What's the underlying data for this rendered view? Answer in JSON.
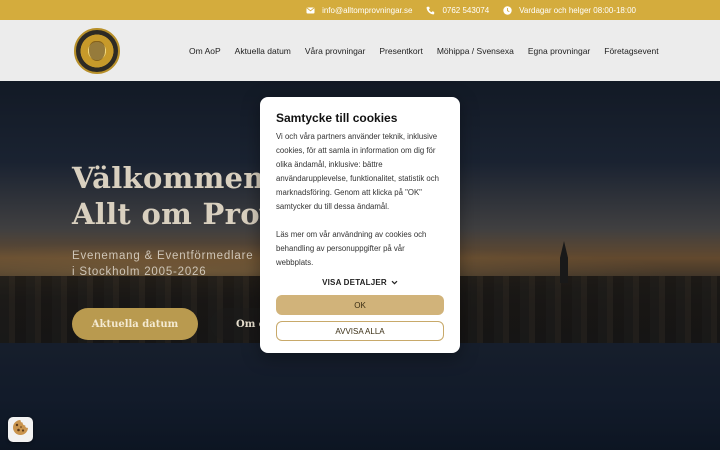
{
  "topbar": {
    "email": "info@alltomprovningar.se",
    "phone": "0762 543074",
    "hours": "Vardagar och helger 08:00-18:00",
    "icons": [
      "mail-icon",
      "phone-icon",
      "clock-icon"
    ]
  },
  "nav": {
    "logo": "logo",
    "items": [
      {
        "label": "Om AoP"
      },
      {
        "label": "Aktuella datum"
      },
      {
        "label": "Våra provningar"
      },
      {
        "label": "Presentkort"
      },
      {
        "label": "Möhippa / Svensexa"
      },
      {
        "label": "Egna provningar"
      },
      {
        "label": "Företagsevent"
      }
    ]
  },
  "hero": {
    "title": "Välkommen till\nAllt om Provningar",
    "subtitle": "Evenemang & Eventförmedlare\ni Stockholm 2005-2026",
    "primary_button": "Aktuella datum",
    "secondary_button": "Om oss"
  },
  "cookie_modal": {
    "title": "Samtycke till cookies",
    "paragraph1": "Vi och våra partners använder teknik, inklusive cookies, för att samla in information om dig för olika ändamål, inklusive: bättre användarupplevelse, funktionalitet, statistik och marknadsföring. Genom att klicka på \"OK\" samtycker du till dessa ändamål.",
    "paragraph2": "Läs mer om vår användning av cookies och behandling av personuppgifter på vår webbplats.",
    "details_label": "VISA DETALJER",
    "ok_label": "OK",
    "reject_label": "AVVISA ALLA"
  },
  "colors": {
    "accent": "#d4ac3d",
    "button_gold": "#d1b37a"
  }
}
